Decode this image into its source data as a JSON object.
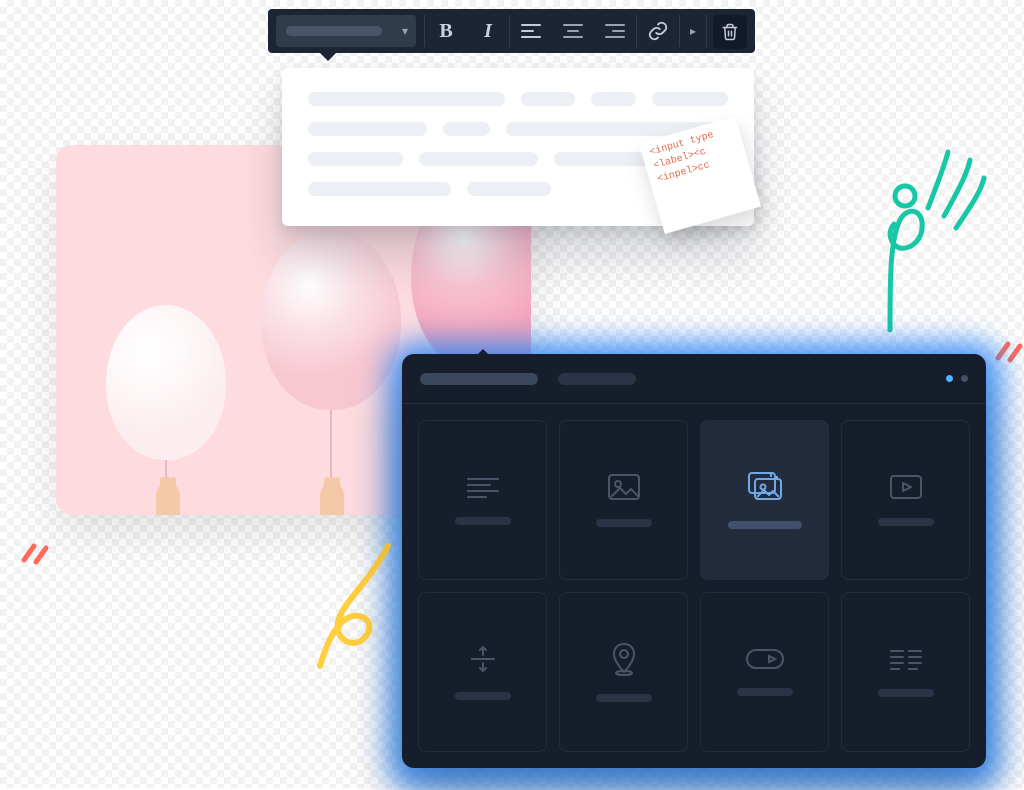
{
  "toolbar": {
    "style_select": {
      "placeholder": ""
    },
    "buttons": {
      "bold": "B",
      "italic": "I",
      "align_left": "align-left",
      "align_center": "align-center",
      "align_right": "align-right",
      "link": "link",
      "more": "▸",
      "delete": "trash"
    }
  },
  "text_block": {
    "rows": [
      [
        52,
        14,
        12,
        20
      ],
      [
        30,
        12,
        56
      ],
      [
        24,
        30,
        44
      ],
      [
        34,
        20
      ]
    ],
    "code_peel": "<input type\n<label><c\n<inpel>cc"
  },
  "picker": {
    "tabs": [
      {
        "active": true,
        "width": 118
      },
      {
        "active": false,
        "width": 78
      }
    ],
    "window_dots": [
      "primary",
      "secondary"
    ],
    "blocks": [
      {
        "id": "text",
        "icon": "text",
        "selected": false
      },
      {
        "id": "image",
        "icon": "image",
        "selected": false
      },
      {
        "id": "gallery",
        "icon": "gallery",
        "selected": true
      },
      {
        "id": "video",
        "icon": "video",
        "selected": false
      },
      {
        "id": "spacer",
        "icon": "spacer",
        "selected": false
      },
      {
        "id": "map",
        "icon": "map-pin",
        "selected": false
      },
      {
        "id": "button",
        "icon": "button",
        "selected": false
      },
      {
        "id": "columns",
        "icon": "columns",
        "selected": false
      }
    ]
  },
  "image_card": {
    "alt": "balloons-photo"
  },
  "colors": {
    "toolbar_bg": "#1c2533",
    "picker_bg": "#161e2c",
    "accent": "#2f8bff",
    "tile_sel": "#222c3d",
    "ok_hand": "#17c7a5",
    "squiggle": "#ffcf3f",
    "dash": "#ff6a5b"
  }
}
